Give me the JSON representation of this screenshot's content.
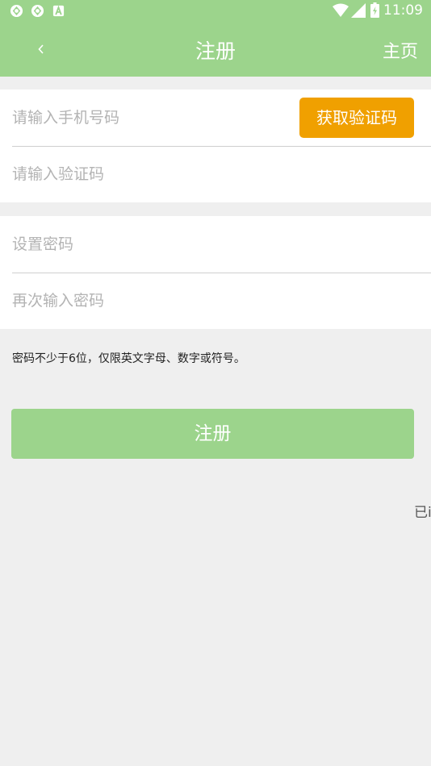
{
  "status_bar": {
    "time": "11:09",
    "left_icons": [
      "app-notification-icon",
      "app-notification-icon",
      "a-letter-icon"
    ],
    "right_icons": [
      "wifi-icon",
      "signal-icon",
      "battery-icon"
    ]
  },
  "app_bar": {
    "back_icon": "chevron-left-icon",
    "title": "注册",
    "home_label": "主页"
  },
  "form": {
    "phone_placeholder": "请输入手机号码",
    "get_code_label": "获取验证码",
    "code_placeholder": "请输入验证码",
    "password_placeholder": "设置密码",
    "confirm_password_placeholder": "再次输入密码"
  },
  "hint": "密码不少于6位，仅限英文字母、数字或符号。",
  "register_label": "注册",
  "login_link_partial": "已i",
  "colors": {
    "primary": "#9cd48c",
    "accent": "#f0a000",
    "background": "#efefef"
  }
}
